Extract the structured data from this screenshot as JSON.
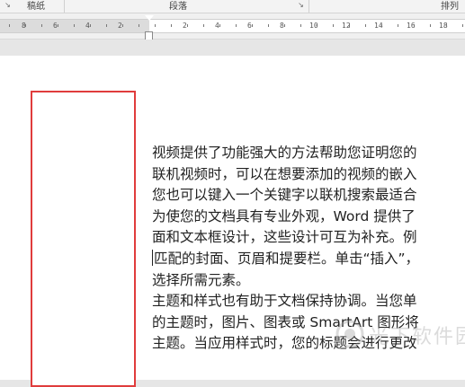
{
  "ribbon": {
    "groups": [
      "稿纸",
      "段落",
      "排列"
    ]
  },
  "ruler": {
    "left_ticks": [
      "8",
      "6",
      "4",
      "2"
    ],
    "right_ticks": [
      "2",
      "4",
      "6",
      "8",
      "10",
      "12",
      "14",
      "16",
      "18",
      "20"
    ]
  },
  "document": {
    "lines": [
      "视频提供了功能强大的方法帮助您证明您的",
      "联机视频时，可以在想要添加的视频的嵌入",
      "您也可以键入一个关键字以联机搜索最适合",
      "为使您的文档具有专业外观，Word 提供了",
      "面和文本框设计，这些设计可互为补充。例",
      "匹配的封面、页眉和提要栏。单击“插入”，",
      "选择所需元素。",
      "主题和样式也有助于文档保持协调。当您单",
      "的主题时，图片、图表或 SmartArt 图形将",
      "主题。当应用样式时，您的标题会进行更改"
    ]
  },
  "watermark": {
    "text": "光下软件园"
  },
  "colors": {
    "textbox_border": "#e03c3c"
  }
}
